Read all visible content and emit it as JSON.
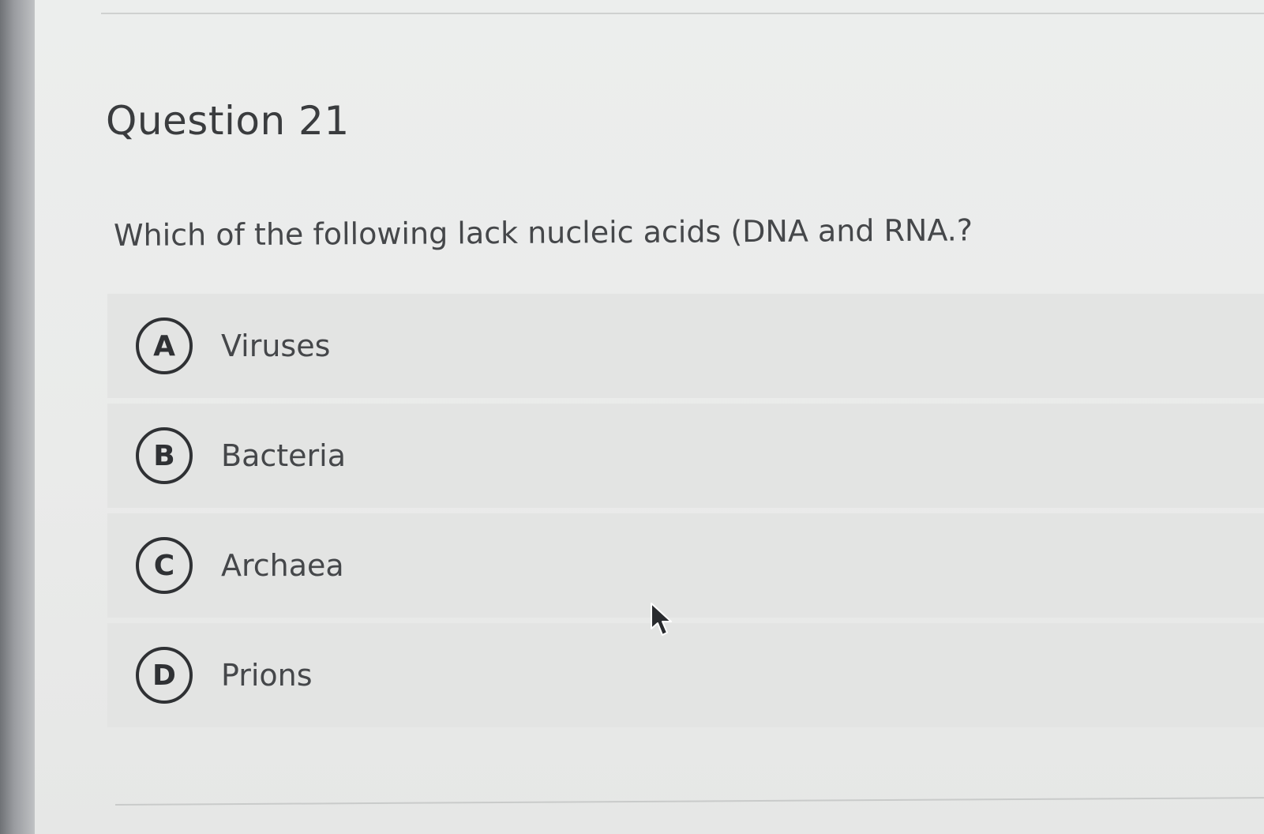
{
  "question": {
    "title": "Question 21",
    "prompt": "Which of the following lack nucleic acids (DNA and RNA.?"
  },
  "options": [
    {
      "letter": "A",
      "label": "Viruses"
    },
    {
      "letter": "B",
      "label": "Bacteria"
    },
    {
      "letter": "C",
      "label": "Archaea"
    },
    {
      "letter": "D",
      "label": "Prions"
    }
  ],
  "icons": {
    "cursor": "mouse-pointer-icon"
  },
  "colors": {
    "page_background": "#eceeed",
    "option_background": "#e3e4e3",
    "text": "#45474a",
    "badge_border": "#2f3134"
  }
}
